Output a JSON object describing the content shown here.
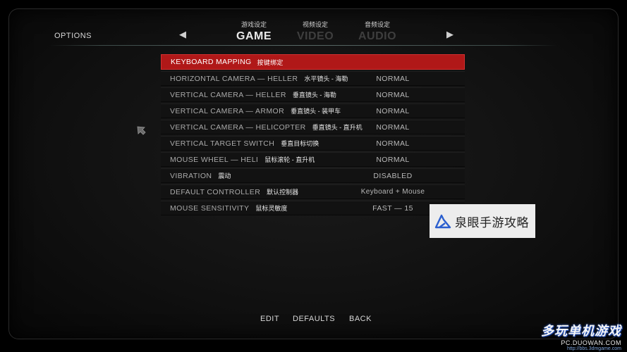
{
  "header": {
    "title": "OPTIONS",
    "left_arrow": "◀",
    "right_arrow": "▶",
    "tabs": [
      {
        "cn": "游戏设定",
        "label": "GAME"
      },
      {
        "cn": "视频设定",
        "label": "VIDEO"
      },
      {
        "cn": "音频设定",
        "label": "AUDIO"
      }
    ]
  },
  "menu": {
    "selected": {
      "label": "KEYBOARD MAPPING",
      "cn": "按键绑定"
    },
    "rows": [
      {
        "label": "HORIZONTAL CAMERA — HELLER",
        "cn": "水平镜头 - 海勒",
        "value": "NORMAL"
      },
      {
        "label": "VERTICAL CAMERA — HELLER",
        "cn": "垂直镜头 - 海勒",
        "value": "NORMAL"
      },
      {
        "label": "VERTICAL CAMERA — ARMOR",
        "cn": "垂直镜头 - 装甲车",
        "value": "NORMAL"
      },
      {
        "label": "VERTICAL CAMERA — HELICOPTER",
        "cn": "垂直镜头 - 直升机",
        "value": "NORMAL"
      },
      {
        "label": "VERTICAL TARGET SWITCH",
        "cn": "垂直目标切换",
        "value": "NORMAL"
      },
      {
        "label": "MOUSE WHEEL — HELI",
        "cn": "鼠标滚轮 - 直升机",
        "value": "NORMAL"
      },
      {
        "label": "VIBRATION",
        "cn": "震动",
        "value": "DISABLED"
      },
      {
        "label": "DEFAULT CONTROLLER",
        "cn": "默认控制器",
        "value": "Keyboard + Mouse"
      },
      {
        "label": "MOUSE SENSITIVITY",
        "cn": "鼠标灵敏度",
        "value": "FAST — 15"
      }
    ]
  },
  "footer": {
    "edit": "EDIT",
    "defaults": "DEFAULTS",
    "back": "BACK"
  },
  "watermarks": {
    "box_text": "泉眼手游攻略",
    "site_name": "多玩单机游戏",
    "site_url": "PC.DUOWAN.COM",
    "small_url": "http://bbs.3dmgame.com"
  },
  "colors": {
    "selected_row": "#b01818",
    "background": "#000000"
  }
}
